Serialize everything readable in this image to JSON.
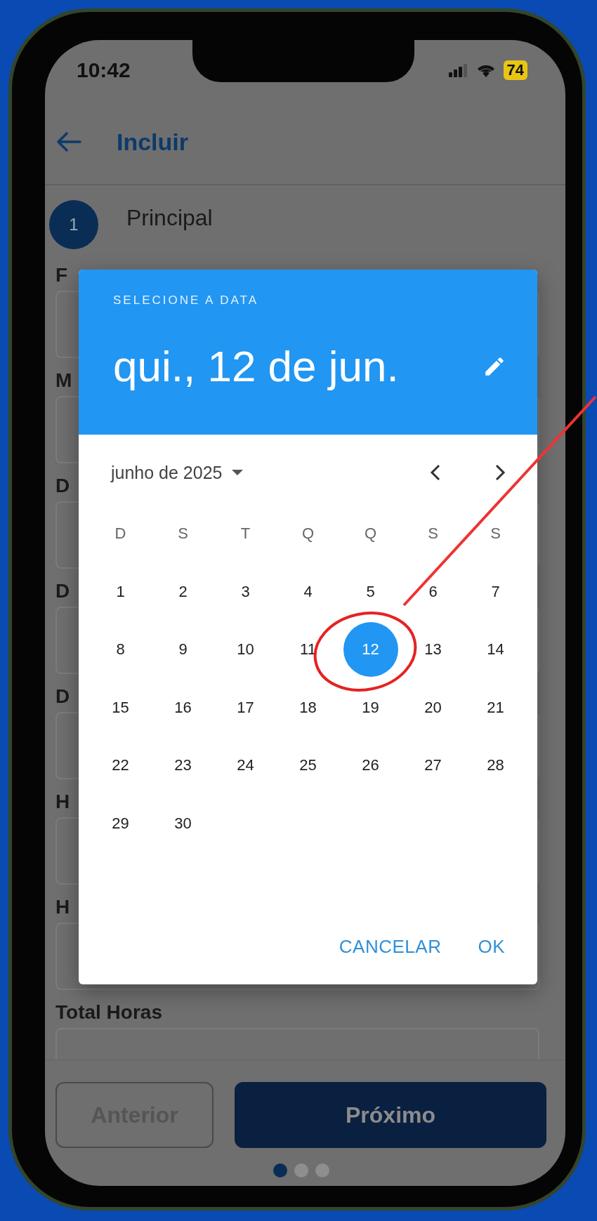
{
  "status_bar": {
    "time": "10:42",
    "battery": "74"
  },
  "app_bar": {
    "title": "Incluir"
  },
  "step": {
    "number": "1",
    "title": "Principal"
  },
  "form_fields": [
    {
      "label": "F"
    },
    {
      "label": "M"
    },
    {
      "label": "D"
    },
    {
      "label": "D"
    },
    {
      "label": "D"
    },
    {
      "label": "H"
    },
    {
      "label": "H"
    },
    {
      "label": "Total Horas"
    }
  ],
  "date_picker": {
    "header_label": "SELECIONE A DATA",
    "selected_date_text": "qui., 12 de jun.",
    "month_label": "junho de 2025",
    "weekdays": [
      "D",
      "S",
      "T",
      "Q",
      "Q",
      "S",
      "S"
    ],
    "days": [
      {
        "label": "1",
        "selected": false
      },
      {
        "label": "2",
        "selected": false
      },
      {
        "label": "3",
        "selected": false
      },
      {
        "label": "4",
        "selected": false
      },
      {
        "label": "5",
        "selected": false
      },
      {
        "label": "6",
        "selected": false
      },
      {
        "label": "7",
        "selected": false
      },
      {
        "label": "8",
        "selected": false
      },
      {
        "label": "9",
        "selected": false
      },
      {
        "label": "10",
        "selected": false
      },
      {
        "label": "11",
        "selected": false
      },
      {
        "label": "12",
        "selected": true
      },
      {
        "label": "13",
        "selected": false
      },
      {
        "label": "14",
        "selected": false
      },
      {
        "label": "15",
        "selected": false
      },
      {
        "label": "16",
        "selected": false
      },
      {
        "label": "17",
        "selected": false
      },
      {
        "label": "18",
        "selected": false
      },
      {
        "label": "19",
        "selected": false
      },
      {
        "label": "20",
        "selected": false
      },
      {
        "label": "21",
        "selected": false
      },
      {
        "label": "22",
        "selected": false
      },
      {
        "label": "23",
        "selected": false
      },
      {
        "label": "24",
        "selected": false
      },
      {
        "label": "25",
        "selected": false
      },
      {
        "label": "26",
        "selected": false
      },
      {
        "label": "27",
        "selected": false
      },
      {
        "label": "28",
        "selected": false
      },
      {
        "label": "29",
        "selected": false
      },
      {
        "label": "30",
        "selected": false
      }
    ],
    "buttons": [
      {
        "label": "CANCELAR"
      },
      {
        "label": "OK"
      }
    ]
  },
  "nav_buttons": [
    {
      "label": "Anterior",
      "kind": "outlined"
    },
    {
      "label": "Próximo",
      "kind": "filled"
    }
  ],
  "page_dots": [
    {
      "selected": true
    },
    {
      "selected": false
    },
    {
      "selected": false
    }
  ]
}
